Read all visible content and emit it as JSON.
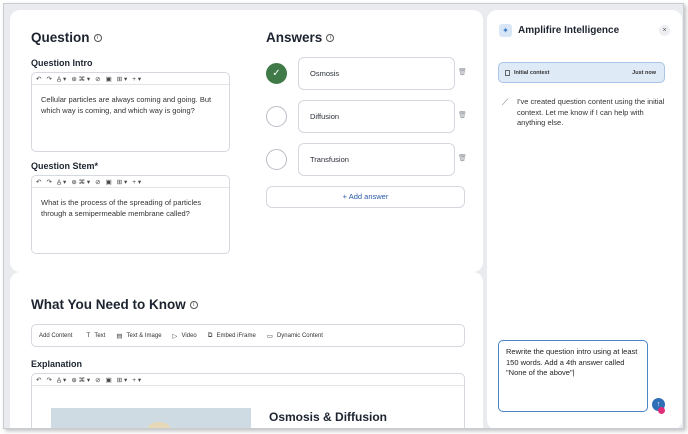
{
  "question": {
    "title": "Question",
    "intro_label": "Question Intro",
    "intro_text": "Cellular particles are always coming and going. But which way is coming, and which way is going?",
    "stem_label": "Question Stem*",
    "stem_text": "What is the process of the spreading of particles through a semipermeable membrane called?"
  },
  "answers": {
    "title": "Answers",
    "items": [
      {
        "label": "Osmosis",
        "correct": true
      },
      {
        "label": "Diffusion",
        "correct": false
      },
      {
        "label": "Transfusion",
        "correct": false
      }
    ],
    "add_label": "+ Add answer"
  },
  "toolbar": {
    "undo": "↶",
    "redo": "↷",
    "text_style": "A̲ ▾",
    "insert": "⊕ ⌘ ▾",
    "link": "⊘",
    "image": "▣",
    "table": "⊞ ▾",
    "more": "+ ▾"
  },
  "knowledge": {
    "title": "What You Need to Know",
    "add_content_label": "Add Content",
    "content_types": [
      {
        "icon": "T",
        "label": "Text"
      },
      {
        "icon": "▤",
        "label": "Text & Image"
      },
      {
        "icon": "▷",
        "label": "Video"
      },
      {
        "icon": "⧉",
        "label": "Embed iFrame"
      },
      {
        "icon": "▭",
        "label": "Dynamic Content"
      }
    ],
    "explanation_label": "Explanation",
    "explanation_heading": "Osmosis & Diffusion"
  },
  "ai_panel": {
    "title": "Amplifire Intelligence",
    "close": "×",
    "context_label": "Initial context",
    "context_time": "Just now",
    "message": "I've created question content using the initial context. Let me know if I can help with anything else.",
    "input_value": "Rewrite the question intro using at least 150 words. Add a 4th answer called \"None of the above\"|",
    "send": "↑"
  },
  "colors": {
    "correct": "#3f7a48",
    "accent": "#2f6fb8",
    "context_bg": "#dfeaf7"
  }
}
